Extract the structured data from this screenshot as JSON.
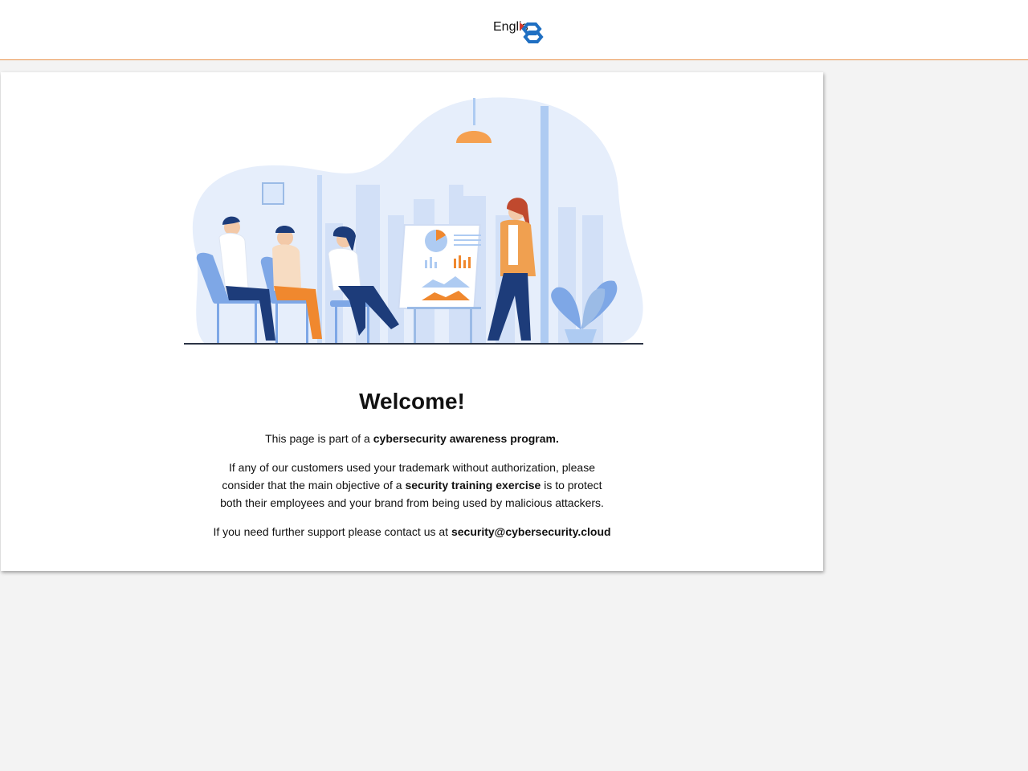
{
  "header": {
    "language_label": "English"
  },
  "main": {
    "title": "Welcome!",
    "intro_prefix": "This page is part of a",
    "intro_bold": "cybersecurity awareness program.",
    "body_prefix": "If any of our customers used your trademark without authorization, please consider that the main objective of a",
    "body_bold": "security training exercise",
    "body_suffix": "is to protect both their employees and your brand from being used by malicious attackers.",
    "contact_prefix": "If you need further support please contact us at",
    "contact_email": "security@cybersecurity.cloud"
  },
  "colors": {
    "accent_orange": "#e8914a",
    "logo_blue": "#1f6fc2",
    "illustration_blue": "#dbe8fb"
  }
}
